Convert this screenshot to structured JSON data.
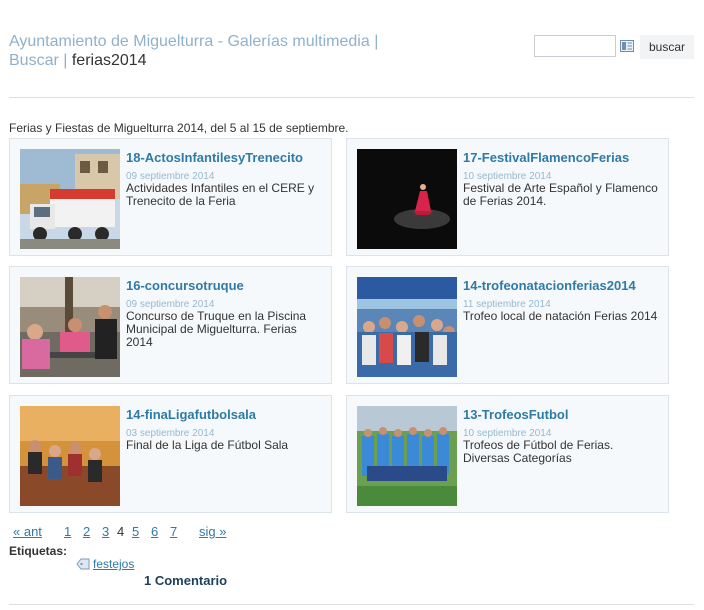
{
  "header": {
    "site": "Ayuntamiento de Miguelturra - Galerías multimedia |",
    "buscar": "Buscar |",
    "current": "ferias2014"
  },
  "search": {
    "value": "",
    "button_label": "buscar"
  },
  "description": "Ferias y Fiestas de Miguelturra 2014, del 5 al 15 de septiembre.",
  "galleries": [
    {
      "title": "18-ActosInfantilesyTrenecito",
      "date": "09 septiembre 2014",
      "description": "Actividades Infantiles en el CERE y Trenecito de la Feria"
    },
    {
      "title": "17-FestivalFlamencoFerias",
      "date": "10 septiembre 2014",
      "description": "Festival de Arte Español y Flamenco de Ferias 2014."
    },
    {
      "title": "16-concursotruque",
      "date": "09 septiembre 2014",
      "description": "Concurso de Truque en la Piscina Municipal de Miguelturra. Ferias 2014"
    },
    {
      "title": "14-trofeonatacionferias2014",
      "date": "11 septiembre 2014",
      "description": "Trofeo local de natación Ferias 2014"
    },
    {
      "title": "14-finaLigafutbolsala",
      "date": "03 septiembre 2014",
      "description": "Final de la Liga de Fútbol Sala"
    },
    {
      "title": "13-TrofeosFutbol",
      "date": "10 septiembre 2014",
      "description": "Trofeos de Fútbol de Ferias. Diversas Categorías"
    }
  ],
  "pagination": {
    "prev": "« ant",
    "pages": [
      "1",
      "2",
      "3",
      "4",
      "5",
      "6",
      "7"
    ],
    "current": "4",
    "next": "sig »"
  },
  "tags": {
    "label": "Etiquetas:",
    "items": [
      "festejos"
    ]
  },
  "comments": "1 Comentario"
}
